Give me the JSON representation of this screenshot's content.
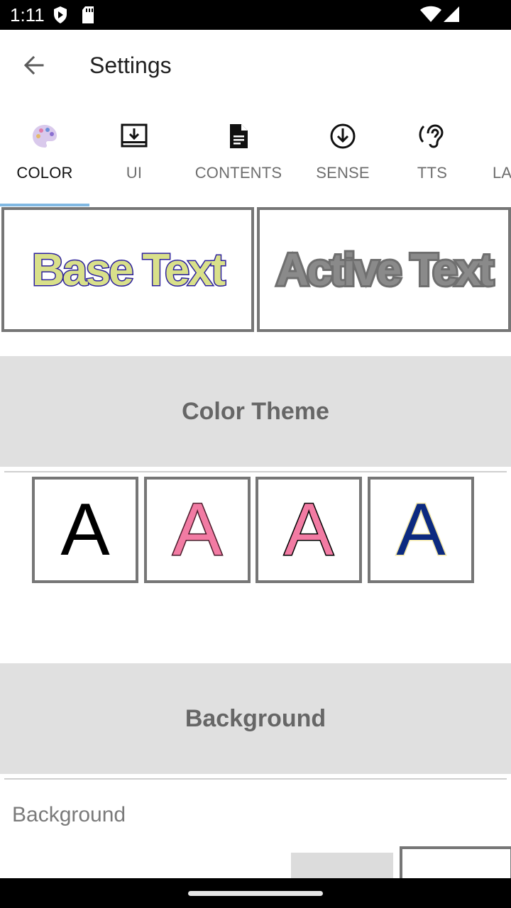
{
  "status_bar": {
    "time": "1:11",
    "icons": [
      "shield-icon",
      "sd-card-icon",
      "wifi-icon",
      "cell-signal-icon"
    ]
  },
  "app_bar": {
    "back_icon": "arrow-back-icon",
    "title": "Settings"
  },
  "tabs": [
    {
      "label": "COLOR",
      "icon": "palette-icon",
      "active": true
    },
    {
      "label": "UI",
      "icon": "download-box-icon",
      "active": false
    },
    {
      "label": "CONTENTS",
      "icon": "document-icon",
      "active": false
    },
    {
      "label": "SENSE",
      "icon": "circle-arrow-down-icon",
      "active": false
    },
    {
      "label": "TTS",
      "icon": "hearing-icon",
      "active": false
    },
    {
      "label": "LA",
      "icon": "",
      "active": false
    }
  ],
  "preview": {
    "base_text": "Base Text",
    "active_text": "Active Text"
  },
  "sections": {
    "color_theme": "Color Theme",
    "background": "Background"
  },
  "themes": [
    {
      "letter": "A",
      "fill": "#000000",
      "stroke": "none"
    },
    {
      "letter": "A",
      "fill": "#f27ba3",
      "stroke": "#4a1a2a"
    },
    {
      "letter": "A",
      "fill": "#f27ba3",
      "stroke": "#000000"
    },
    {
      "letter": "A",
      "fill": "#0c2a80",
      "stroke": "#f3e7a8"
    }
  ],
  "background_row": {
    "label": "Background"
  },
  "colors": {
    "tab_indicator": "#80b8e2",
    "section_bg": "#e0e0e0",
    "border": "#767676"
  }
}
